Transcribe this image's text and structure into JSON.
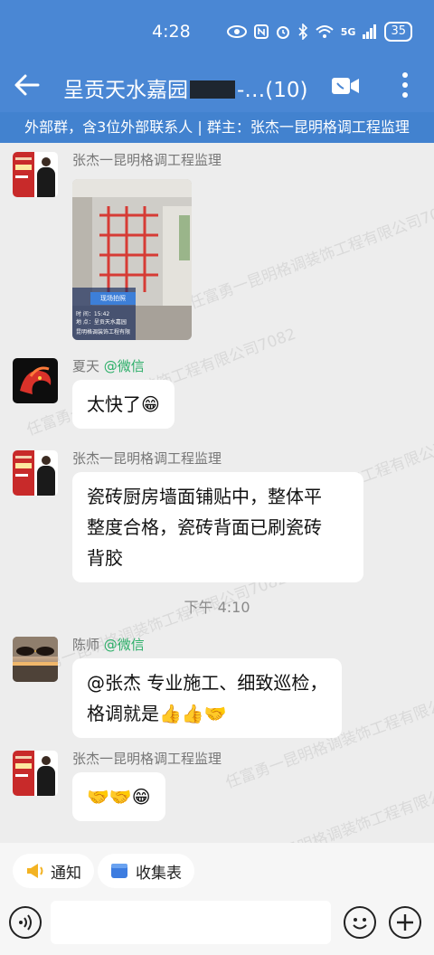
{
  "status_bar": {
    "time": "4:28",
    "network": "5G",
    "battery": "35"
  },
  "header": {
    "title": "呈贡天水嘉园",
    "title_suffix": "-…(10)",
    "subtitle": "外部群，含3位外部联系人 | 群主：张杰一昆明格调工程监理"
  },
  "messages": [
    {
      "sender": "张杰一昆明格调工程监理",
      "type": "image"
    },
    {
      "sender": "夏天",
      "sender_suffix": "@微信",
      "text": "太快了😁"
    },
    {
      "sender": "张杰一昆明格调工程监理",
      "lines": [
        "瓷砖厨房墙面铺贴中，整体平",
        "整度合格，瓷砖背面已刷瓷砖",
        "背胶"
      ]
    },
    {
      "timestamp": "下午 4:10"
    },
    {
      "sender": "陈师",
      "sender_suffix": "@微信",
      "lines": [
        "@张杰 专业施工、细致巡检，",
        "格调就是👍👍🤝"
      ]
    },
    {
      "sender": "张杰一昆明格调工程监理",
      "text": "🤝🤝😁"
    }
  ],
  "photo_overlay": {
    "title": "现场拍照",
    "lines": [
      "时 间：15:42",
      "地 点：呈贡天水嘉园"
    ],
    "footer": "昆明格调装饰工程有限"
  },
  "watermark": "任富勇一昆明格调装饰工程有限公司7082",
  "quick_actions": [
    {
      "label": "通知",
      "icon": "megaphone-icon"
    },
    {
      "label": "收集表",
      "icon": "form-icon"
    }
  ],
  "colors": {
    "header": "#4a87d4",
    "subbar": "#4282cf",
    "wechat_green": "#2aae67",
    "background": "#ededed"
  }
}
